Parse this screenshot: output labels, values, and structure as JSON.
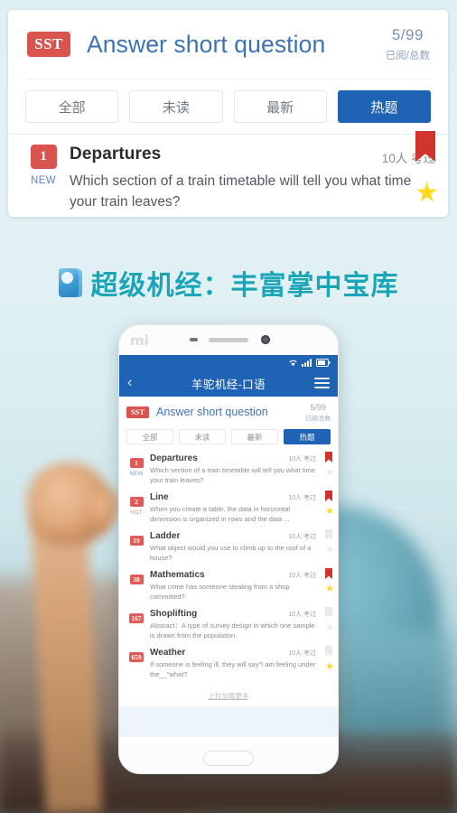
{
  "card": {
    "badge": "SST",
    "title": "Answer short question",
    "count": "5/99",
    "count_label": "已阅/总数",
    "filters": [
      {
        "label": "全部",
        "active": false
      },
      {
        "label": "未读",
        "active": false
      },
      {
        "label": "最新",
        "active": false
      },
      {
        "label": "热题",
        "active": true
      }
    ],
    "question": {
      "number": "1",
      "tag": "NEW",
      "title": "Departures",
      "meta": "10人 考过",
      "text": "Which section of a train timetable will tell you what time your train leaves?"
    }
  },
  "headline": {
    "icon": "book-icon",
    "text": "超级机经：丰富掌中宝库"
  },
  "phone": {
    "brand": "mi",
    "appbar": {
      "back": "‹",
      "title": "羊驼机经-口语",
      "menu": "hamburger-icon"
    },
    "subhead": {
      "badge": "SST",
      "title": "Answer short question",
      "count": "5/99",
      "count_label": "已阅/总数"
    },
    "filters": [
      {
        "label": "全部",
        "active": false
      },
      {
        "label": "未读",
        "active": false
      },
      {
        "label": "最新",
        "active": false
      },
      {
        "label": "热题",
        "active": true
      }
    ],
    "items": [
      {
        "number": "1",
        "tag": "NEW",
        "title": "Departures",
        "meta": "10人 考过",
        "text": "Which section of a train timetable will tell you what time your train leaves?",
        "bookmarked": true,
        "starred": false
      },
      {
        "number": "2",
        "tag": "HOT",
        "title": "Line",
        "meta": "10人 考过",
        "text": "When you create a table, the data in horizontal dimension is organized in rows and the data ...",
        "bookmarked": true,
        "starred": true
      },
      {
        "number": "19",
        "tag": "",
        "title": "Ladder",
        "meta": "10人 考过",
        "text": "What object would you use to climb up to the roof of a house?",
        "bookmarked": false,
        "starred": false
      },
      {
        "number": "38",
        "tag": "",
        "title": "Mathematics",
        "meta": "10人 考过",
        "text": "What crime has someone stealing from a shop committed?",
        "bookmarked": true,
        "starred": true
      },
      {
        "number": "167",
        "tag": "",
        "title": "Shoplifting",
        "meta": "10人 考过",
        "text": "Abstract：A type of survey design in which one sample is drawn from the population.",
        "bookmarked": false,
        "starred": false
      },
      {
        "number": "659",
        "tag": "",
        "title": "Weather",
        "meta": "10人 考过",
        "text": "If someone is feeling ill, they will say\"I am feeling under the__\"what?",
        "bookmarked": false,
        "starred": true
      }
    ],
    "load_more": "上拉加载更多"
  },
  "colors": {
    "brand_blue": "#1f63b4",
    "title_blue": "#3d72b5",
    "badge_red": "#d9534f",
    "teal": "#1aa6b8",
    "star_yellow": "#ffd91e",
    "ribbon_red": "#d0342c"
  }
}
